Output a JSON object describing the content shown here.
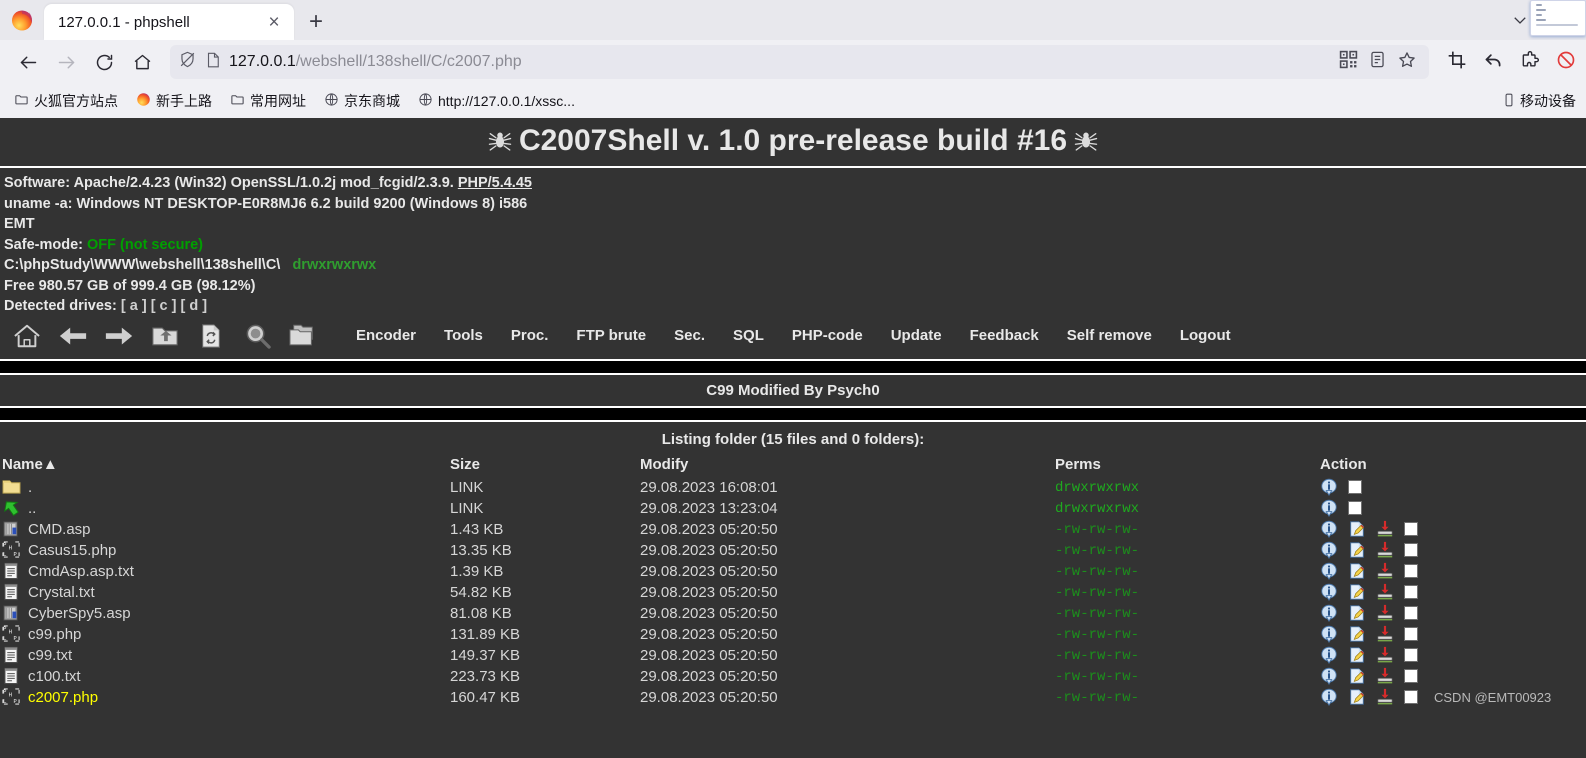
{
  "browser": {
    "tab": {
      "title": "127.0.0.1 - phpshell",
      "close_label": "×"
    },
    "new_tab_label": "+",
    "minimize_label": "—",
    "url": {
      "host": "127.0.0.1",
      "path": "/webshell/138shell/C/c2007.php"
    },
    "nav": {
      "back": "back-arrow",
      "forward": "forward-arrow",
      "reload": "reload",
      "home": "home"
    },
    "url_icons": [
      "shield-off-icon",
      "page-icon",
      "qr-code-icon",
      "reader-mode-icon",
      "bookmark-star-icon"
    ],
    "toolbar_icons": [
      "crop-icon",
      "undo-icon",
      "extension-icon",
      "blocked-icon"
    ],
    "bookmarks": [
      {
        "label": "火狐官方站点",
        "icon": "folder-icon"
      },
      {
        "label": "新手上路",
        "icon": "firefox-icon"
      },
      {
        "label": "常用网址",
        "icon": "folder-icon"
      },
      {
        "label": "京东商城",
        "icon": "globe-icon"
      },
      {
        "label": "http://127.0.0.1/xssc...",
        "icon": "globe-icon"
      }
    ],
    "bookmarks_right": {
      "label": "移动设备",
      "icon": "mobile-icon"
    }
  },
  "shell": {
    "title": "C2007Shell v. 1.0 pre-release build #16",
    "info": {
      "software_label": "Software:",
      "software_value": " Apache/2.4.23 (Win32) OpenSSL/1.0.2j mod_fcgid/2.3.9. ",
      "software_link": "PHP/5.4.45",
      "uname_label": "uname -a:",
      "uname_value": " Windows NT DESKTOP-E0R8MJ6 6.2 build 9200 (Windows 8) i586",
      "user_value": "EMT",
      "safemode_label": "Safe-mode:",
      "safemode_value": "OFF (not secure)",
      "cwd": "C:\\phpStudy\\WWW\\webshell\\138shell\\C\\",
      "cwd_perms": "drwxrwxrwx",
      "free": "Free 980.57 GB of 999.4 GB (98.12%)",
      "drives_label": "Detected drives:",
      "drives": [
        "a",
        "c",
        "d"
      ]
    },
    "toolbar": {
      "icons": [
        "home-icon",
        "back-arrow-icon",
        "forward-arrow-icon",
        "folder-up-icon",
        "refresh-file-icon",
        "search-icon",
        "copy-folder-icon"
      ],
      "links": [
        "Encoder",
        "Tools",
        "Proc.",
        "FTP brute",
        "Sec.",
        "SQL",
        "PHP-code",
        "Update",
        "Feedback",
        "Self remove",
        "Logout"
      ]
    },
    "banner": "C99 Modified By Psych0",
    "listing_caption": "Listing folder (15 files and 0 folders):",
    "columns": {
      "name": "Name",
      "sort_arrow": "▲",
      "size": "Size",
      "modify": "Modify",
      "perms": "Perms",
      "action": "Action"
    },
    "rows": [
      {
        "icon": "folder-icon",
        "name": ".",
        "size": "LINK",
        "modify": "29.08.2023 16:08:01",
        "perms": "drwxrwxrwx",
        "perm_type": "dir",
        "current": false,
        "actions": [
          "info",
          "checkbox"
        ]
      },
      {
        "icon": "folder-up-icon",
        "name": "..",
        "size": "LINK",
        "modify": "29.08.2023 13:23:04",
        "perms": "drwxrwxrwx",
        "perm_type": "dir",
        "current": false,
        "actions": [
          "info",
          "checkbox"
        ]
      },
      {
        "icon": "asp-icon",
        "name": "CMD.asp",
        "size": "1.43 KB",
        "modify": "29.08.2023 05:20:50",
        "perms": "-rw-rw-rw-",
        "perm_type": "file",
        "current": false,
        "actions": [
          "info",
          "edit",
          "download",
          "checkbox"
        ]
      },
      {
        "icon": "php-icon",
        "name": "Casus15.php",
        "size": "13.35 KB",
        "modify": "29.08.2023 05:20:50",
        "perms": "-rw-rw-rw-",
        "perm_type": "file",
        "current": false,
        "actions": [
          "info",
          "edit",
          "download",
          "checkbox"
        ]
      },
      {
        "icon": "txt-icon",
        "name": "CmdAsp.asp.txt",
        "size": "1.39 KB",
        "modify": "29.08.2023 05:20:50",
        "perms": "-rw-rw-rw-",
        "perm_type": "file",
        "current": false,
        "actions": [
          "info",
          "edit",
          "download",
          "checkbox"
        ]
      },
      {
        "icon": "txt-icon",
        "name": "Crystal.txt",
        "size": "54.82 KB",
        "modify": "29.08.2023 05:20:50",
        "perms": "-rw-rw-rw-",
        "perm_type": "file",
        "current": false,
        "actions": [
          "info",
          "edit",
          "download",
          "checkbox"
        ]
      },
      {
        "icon": "asp-icon",
        "name": "CyberSpy5.asp",
        "size": "81.08 KB",
        "modify": "29.08.2023 05:20:50",
        "perms": "-rw-rw-rw-",
        "perm_type": "file",
        "current": false,
        "actions": [
          "info",
          "edit",
          "download",
          "checkbox"
        ]
      },
      {
        "icon": "php-icon",
        "name": "c99.php",
        "size": "131.89 KB",
        "modify": "29.08.2023 05:20:50",
        "perms": "-rw-rw-rw-",
        "perm_type": "file",
        "current": false,
        "actions": [
          "info",
          "edit",
          "download",
          "checkbox"
        ]
      },
      {
        "icon": "txt-icon",
        "name": "c99.txt",
        "size": "149.37 KB",
        "modify": "29.08.2023 05:20:50",
        "perms": "-rw-rw-rw-",
        "perm_type": "file",
        "current": false,
        "actions": [
          "info",
          "edit",
          "download",
          "checkbox"
        ]
      },
      {
        "icon": "txt-icon",
        "name": "c100.txt",
        "size": "223.73 KB",
        "modify": "29.08.2023 05:20:50",
        "perms": "-rw-rw-rw-",
        "perm_type": "file",
        "current": false,
        "actions": [
          "info",
          "edit",
          "download",
          "checkbox"
        ]
      },
      {
        "icon": "php-icon",
        "name": "c2007.php",
        "size": "160.47 KB",
        "modify": "29.08.2023 05:20:50",
        "perms": "-rw-rw-rw-",
        "perm_type": "file",
        "current": true,
        "actions": [
          "info",
          "edit",
          "download",
          "checkbox"
        ]
      }
    ],
    "watermark": "CSDN @EMT00923"
  },
  "colors": {
    "page_bg": "#333333",
    "text": "#e8e8e8",
    "perm_green": "#1faa1f",
    "current_file": "#ffff00",
    "chrome_bg": "#f0f0f4"
  }
}
